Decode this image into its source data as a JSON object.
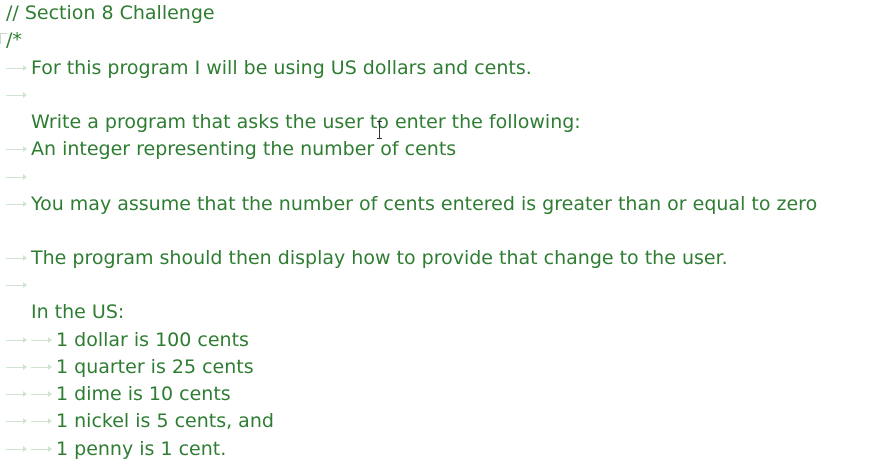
{
  "editor": {
    "text_color": "#2e7d32",
    "lines": [
      {
        "text": "// Section 8 Challenge",
        "indent": 0
      },
      {
        "text": "/*",
        "indent": 0
      },
      {
        "text": "For this program I will be using US dollars and cents.",
        "indent": 1
      },
      {
        "text": "",
        "indent": 1
      },
      {
        "text": "Write a program that asks the user to enter the following:",
        "indent": 1
      },
      {
        "text": "An integer representing the number of cents",
        "indent": 1
      },
      {
        "text": "",
        "indent": 1
      },
      {
        "text": "You may assume that the number of cents entered is greater than or equal to zero",
        "indent": 1
      },
      {
        "text": "",
        "indent": 0
      },
      {
        "text": "The program should then display how to provide that change to the user.",
        "indent": 1
      },
      {
        "text": "",
        "indent": 0
      },
      {
        "text": "In the US:",
        "indent": 1
      },
      {
        "text": "1 dollar is 100 cents",
        "indent": 2
      },
      {
        "text": "1 quarter is 25 cents",
        "indent": 2
      },
      {
        "text": "1 dime is 10 cents",
        "indent": 2
      },
      {
        "text": "1 nickel is 5 cents, and",
        "indent": 2
      },
      {
        "text": "1 penny is 1 cent.",
        "indent": 2
      }
    ]
  }
}
